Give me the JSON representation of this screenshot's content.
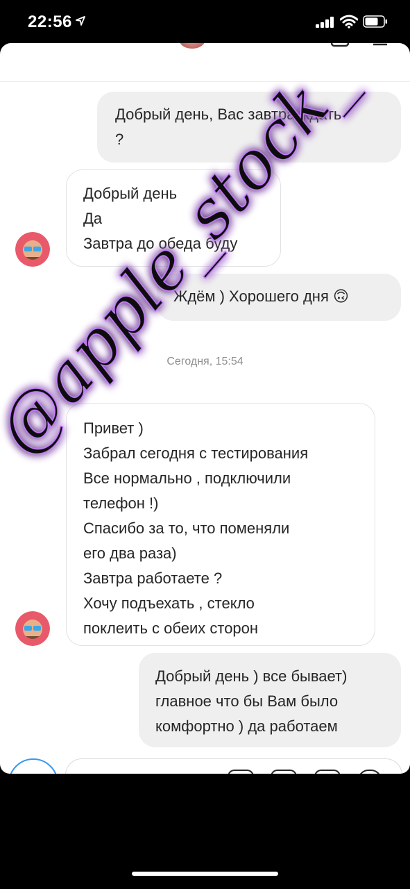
{
  "status_bar": {
    "time": "22:56"
  },
  "messages": [
    {
      "dir": "out",
      "lines": [
        "Добрый день, Вас завтра ждать",
        "?"
      ]
    },
    {
      "dir": "in",
      "lines": [
        "Добрый день",
        "Да",
        "Завтра до обеда буду"
      ]
    },
    {
      "dir": "out",
      "lines": [
        "Ждём ) Хорошего дня 🙃"
      ]
    },
    {
      "dir": "in",
      "lines": [
        "Привет )",
        "Забрал сегодня с тестирования",
        "Все нормально , подключили",
        "телефон !)",
        "Спасибо за то, что поменяли",
        "его два раза)",
        "Завтра работаете ?",
        "Хочу подъехать , стекло",
        "поклеить с обеих сторон"
      ]
    },
    {
      "dir": "out",
      "lines": [
        "Добрый день ) все бывает)",
        "главное что бы Вам было",
        "комфортно ) да работаем"
      ]
    }
  ],
  "timestamp": "Сегодня, 15:54",
  "watermark": "@apple_stock_",
  "colors": {
    "accent": "#3897f0",
    "outgoing_bubble": "#efefef",
    "watermark_glow": "#c77dff"
  },
  "icons": [
    "location-arrow-icon",
    "signal-icon",
    "wifi-icon",
    "battery-icon",
    "camera-icon",
    "microphone-icon",
    "gallery-icon",
    "sticker-icon",
    "heart-icon"
  ]
}
